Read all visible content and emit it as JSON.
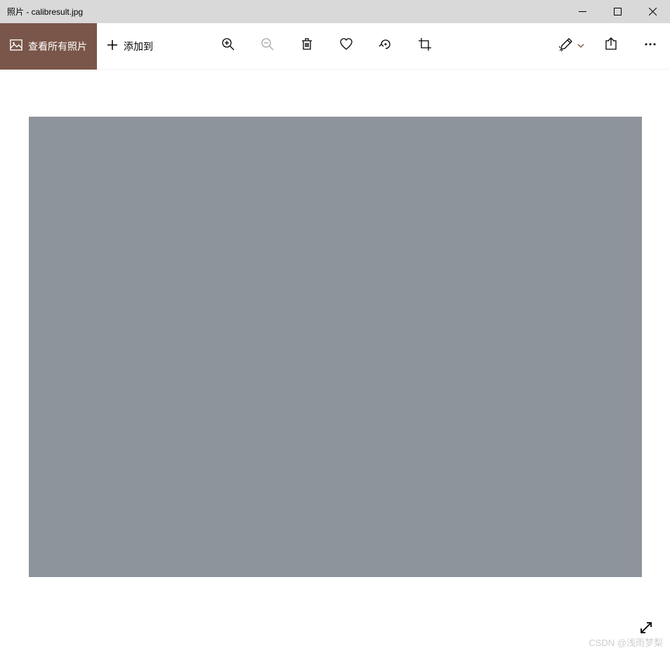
{
  "titlebar": {
    "text": "照片 - calibresult.jpg"
  },
  "toolbar": {
    "view_all_label": "查看所有照片",
    "add_to_label": "添加到"
  },
  "watermark": {
    "text": "CSDN @浅雨梦梨"
  }
}
